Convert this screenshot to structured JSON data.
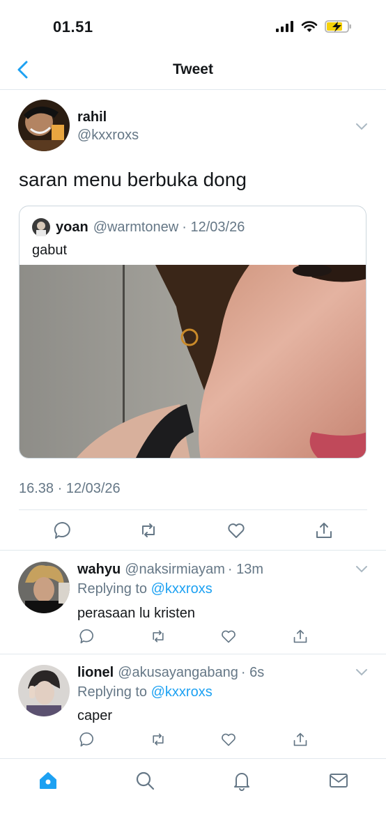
{
  "status_bar": {
    "time": "01.51"
  },
  "nav": {
    "title": "Tweet"
  },
  "tweet": {
    "author_name": "rahil",
    "author_handle": "@kxxroxs",
    "text": "saran menu berbuka dong",
    "timestamp": "16.38 · 12/03/26",
    "quote": {
      "name": "yoan",
      "handle": "@warmtonew",
      "date": "· 12/03/26",
      "text": "gabut"
    }
  },
  "replies": [
    {
      "name": "wahyu",
      "handle": "@naksirmiayam",
      "time": "· 13m",
      "replying_prefix": "Replying to",
      "replying_to": "@kxxroxs",
      "text": "perasaan lu kristen"
    },
    {
      "name": "lionel",
      "handle": "@akusayangabang",
      "time": "· 6s",
      "replying_prefix": "Replying to",
      "replying_to": "@kxxroxs",
      "text": "caper"
    }
  ],
  "colors": {
    "accent": "#1da1f2",
    "muted": "#657786",
    "border": "#e1e8ed"
  },
  "icons": [
    "back-chevron-icon",
    "reply-icon",
    "retweet-icon",
    "like-icon",
    "share-icon",
    "home-icon",
    "search-icon",
    "notifications-icon",
    "messages-icon"
  ]
}
